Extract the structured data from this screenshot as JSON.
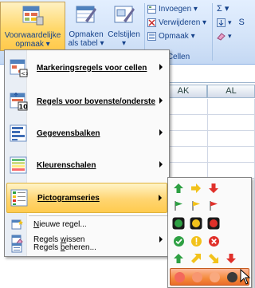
{
  "ribbon": {
    "conditional_formatting": {
      "line1": "Voorwaardelijke",
      "line2": "opmaak ▾",
      "icon": "conditional-formatting-icon"
    },
    "format_table": {
      "line1": "Opmaken",
      "line2": "als tabel ▾",
      "icon": "format-table-icon"
    },
    "cell_styles": {
      "line1": "Celstijlen",
      "line2": "▾",
      "icon": "cell-styles-icon"
    },
    "cells_group": {
      "insert": "Invoegen ▾",
      "delete": "Verwijderen ▾",
      "format": "Opmaak ▾",
      "label": "Cellen"
    },
    "sum_symbol": "Σ ▾",
    "partial_label": "S"
  },
  "sheet": {
    "columns": [
      "AK",
      "AL"
    ]
  },
  "menu": {
    "items": [
      {
        "label": "Markeringsregels voor cellen",
        "icon": "highlight-cells-icon"
      },
      {
        "label": "Regels voor bovenste/onderste",
        "icon": "top-bottom-icon"
      },
      {
        "label": "Gegevensbalken",
        "icon": "data-bars-icon"
      },
      {
        "label": "Kleurenschalen",
        "icon": "color-scales-icon"
      },
      {
        "label": "Pictogramseries",
        "icon": "icon-sets-icon"
      }
    ],
    "actions": [
      {
        "pre": "",
        "u": "N",
        "post": "ieuwe regel...",
        "icon": "new-rule-icon"
      },
      {
        "pre": "Regels ",
        "u": "w",
        "post": "issen",
        "icon": "clear-rules-icon"
      },
      {
        "pre": "Regels ",
        "u": "b",
        "post": "eheren...",
        "icon": "manage-rules-icon"
      }
    ]
  },
  "colors": {
    "green": "#2ea043",
    "yellow": "#f2c21b",
    "red": "#e0302a",
    "black": "#1a1a1a",
    "highlight": "#ffd571"
  }
}
